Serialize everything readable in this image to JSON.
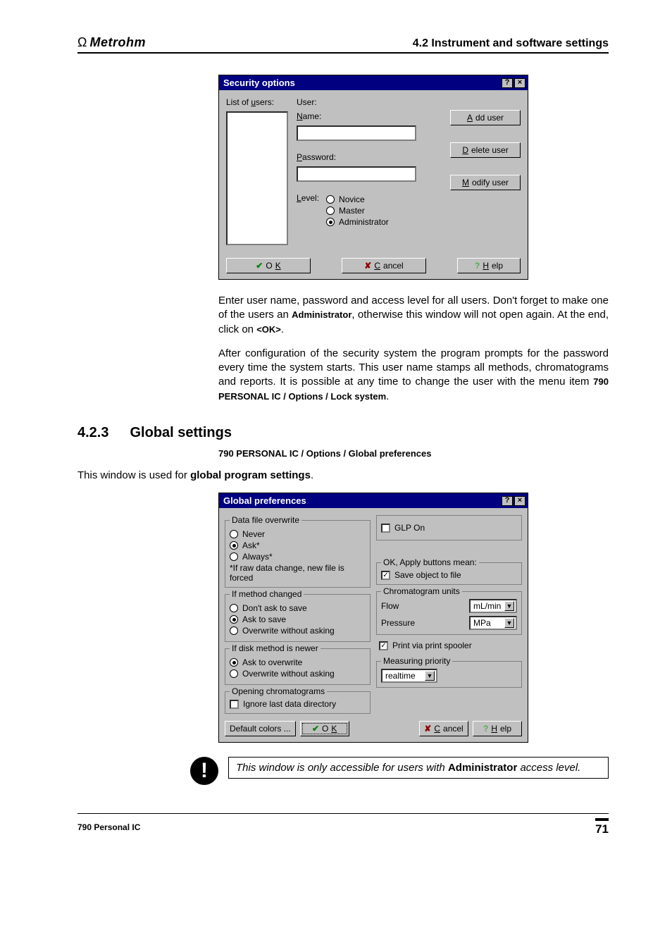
{
  "header": {
    "brand": "Metrohm",
    "sectionTitle": "4.2  Instrument and software settings"
  },
  "securityWin": {
    "title": "Security options",
    "labels": {
      "listOfUsers": "List of users:",
      "user": "User:",
      "name": "Name:",
      "password": "Password:",
      "level": "Level:",
      "novice": "Novice",
      "master": "Master",
      "administrator": "Administrator",
      "addUser": "Add user",
      "deleteUser": "Delete user",
      "modifyUser": "Modify user",
      "ok": "OK",
      "cancel": "Cancel",
      "help": "Help"
    }
  },
  "para1": {
    "t1": "Enter user name, password and access level for all users. Don't forget to make one of the users an ",
    "b1": "Administrator",
    "t2": ", otherwise this window will not open again. At the end, click on ",
    "b2": "<OK>",
    "t3": "."
  },
  "para2": {
    "t1": "After configuration of the security system the program prompts for the password every time the system starts. This user name stamps all methods, chromatograms and reports. It is possible at any time to change the user with the menu item ",
    "b1": "790 PERSONAL IC / Options / Lock system",
    "t2": "."
  },
  "section423": {
    "num": "4.2.3",
    "title": "Global settings",
    "menupath": "790 PERSONAL IC / Options / Global preferences",
    "intro_t1": "This window is used for ",
    "intro_b": "global program settings",
    "intro_t2": "."
  },
  "gpWin": {
    "title": "Global preferences",
    "dfo": {
      "legend": "Data file overwrite",
      "never": "Never",
      "ask": "Ask*",
      "always": "Always*",
      "note": "*If raw data change, new file is forced"
    },
    "imc": {
      "legend": "If method changed",
      "dont": "Don't ask to save",
      "ask": "Ask to save",
      "over": "Overwrite without asking"
    },
    "idn": {
      "legend": "If disk method is newer",
      "ask": "Ask to overwrite",
      "over": "Overwrite without asking"
    },
    "oc": {
      "legend": "Opening chromatograms",
      "ignore": "Ignore last data directory"
    },
    "glp": "GLP On",
    "okApply": {
      "legend": "OK, Apply buttons mean:",
      "save": "Save object to file"
    },
    "cu": {
      "legend": "Chromatogram units",
      "flow": "Flow",
      "flowUnit": "mL/min",
      "pressure": "Pressure",
      "pressureUnit": "MPa"
    },
    "print": "Print via print spooler",
    "mp": {
      "legend": "Measuring priority",
      "value": "realtime"
    },
    "defaultColors": "Default colors ...",
    "ok": "OK",
    "cancel": "Cancel",
    "help": "Help"
  },
  "note": {
    "t1": "This window is only accessible for users with ",
    "b": "Administrator",
    "t2": " access level."
  },
  "footer": {
    "left": "790 Personal IC",
    "page": "71"
  }
}
